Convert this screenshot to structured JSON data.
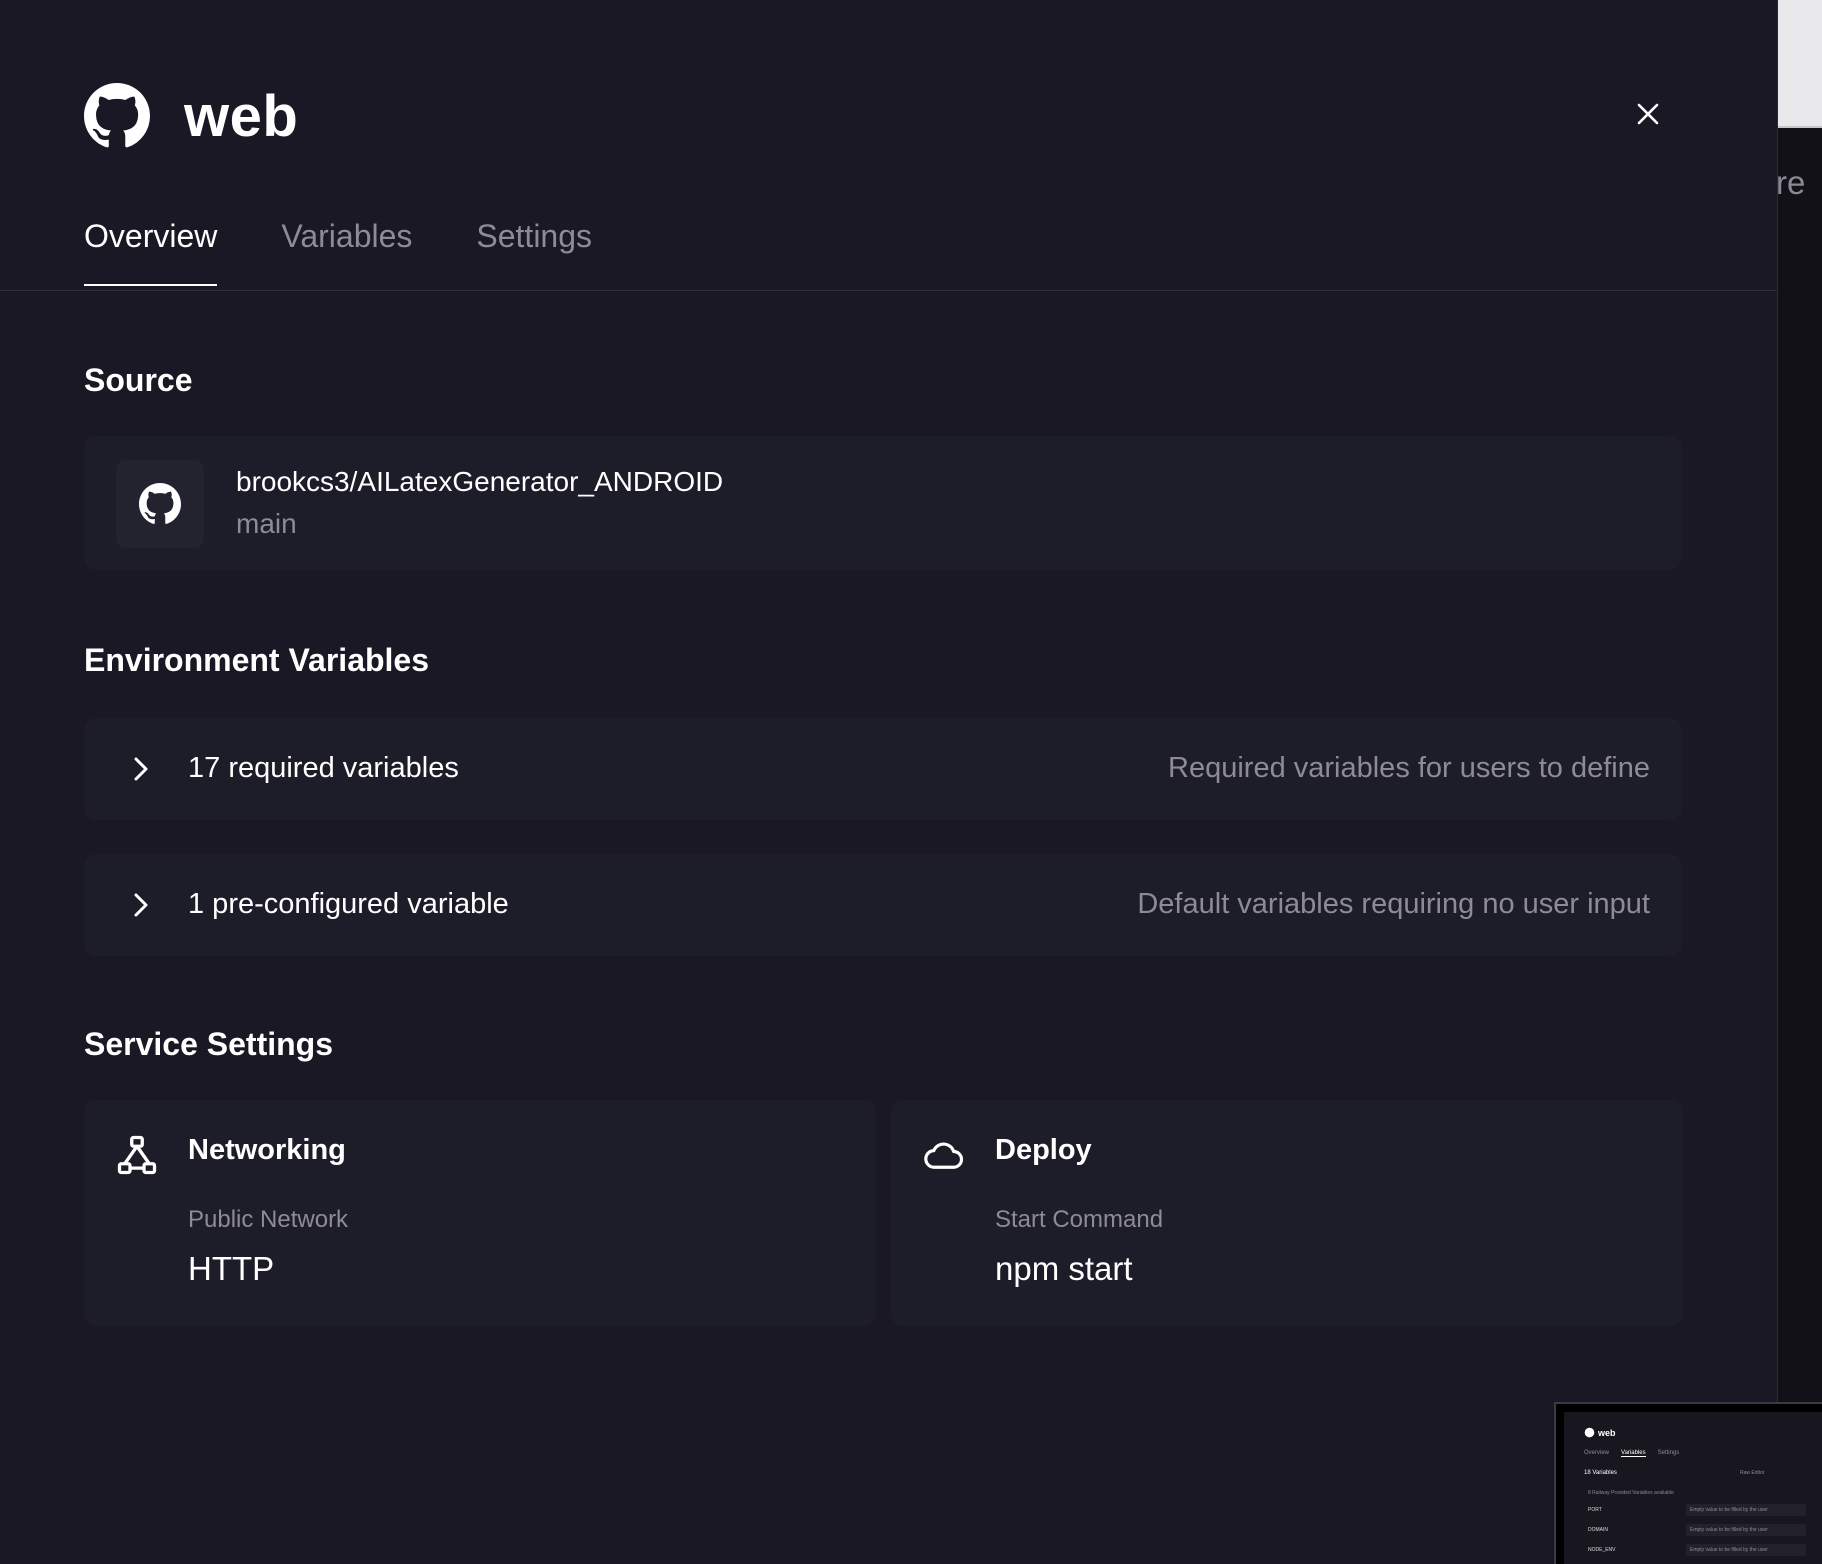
{
  "header": {
    "title": "web",
    "icon": "github-icon"
  },
  "tabs": [
    {
      "label": "Overview",
      "active": true
    },
    {
      "label": "Variables",
      "active": false
    },
    {
      "label": "Settings",
      "active": false
    }
  ],
  "source": {
    "section_title": "Source",
    "repo": "brookcs3/AILatexGenerator_ANDROID",
    "branch": "main",
    "icon": "github-icon"
  },
  "env": {
    "section_title": "Environment Variables",
    "rows": [
      {
        "label": "17 required variables",
        "description": "Required variables for users to define",
        "icon": "chevron-right-icon"
      },
      {
        "label": "1 pre-configured variable",
        "description": "Default variables requiring no user input",
        "icon": "chevron-right-icon"
      }
    ]
  },
  "service": {
    "section_title": "Service Settings",
    "cards": [
      {
        "title": "Networking",
        "label": "Public Network",
        "value": "HTTP",
        "icon": "network-icon"
      },
      {
        "title": "Deploy",
        "label": "Start Command",
        "value": "npm start",
        "icon": "cloud-icon"
      }
    ]
  },
  "background": {
    "partial_text": "re"
  },
  "thumbnail": {
    "title": "web",
    "tabs": [
      "Overview",
      "Variables",
      "Settings"
    ],
    "variables_count": "18 Variables",
    "raw_editor": "Raw Editor",
    "provided_note": "8 Railway Provided Variables available",
    "rows": [
      {
        "key": "PORT",
        "placeholder": "Empty value to be filled by the user"
      },
      {
        "key": "DOMAIN",
        "placeholder": "Empty value to be filled by the user"
      },
      {
        "key": "NODE_ENV",
        "placeholder": "Empty value to be filled by the user"
      }
    ]
  },
  "colors": {
    "background": "#191824",
    "card": "#1d1c29",
    "muted_text": "#8c8b96",
    "text": "#ffffff"
  }
}
